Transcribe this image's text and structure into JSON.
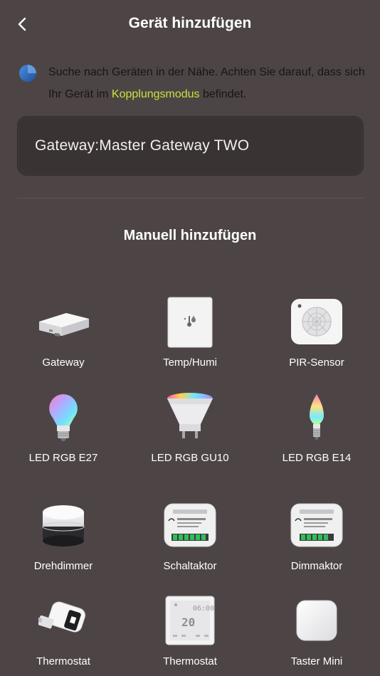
{
  "header": {
    "title": "Gerät hinzufügen"
  },
  "scan": {
    "text_before": "Suche nach Geräten in der Nähe. Achten Sie darauf, dass sich Ihr Gerät im ",
    "link": "Kopplungsmodus",
    "text_after": " befindet.",
    "link_color": "#c8e23c"
  },
  "gateway_card": {
    "label": "Gateway:Master Gateway TWO"
  },
  "manual": {
    "title": "Manuell hinzufügen"
  },
  "devices": [
    {
      "label": "Gateway",
      "icon": "gateway-hub-icon"
    },
    {
      "label": "Temp/Humi",
      "icon": "temp-humidity-sensor-icon"
    },
    {
      "label": "PIR-Sensor",
      "icon": "pir-motion-sensor-icon"
    },
    {
      "label": "LED RGB E27",
      "icon": "led-bulb-e27-icon"
    },
    {
      "label": "LED RGB GU10",
      "icon": "led-spot-gu10-icon"
    },
    {
      "label": "LED RGB E14",
      "icon": "led-candle-e14-icon"
    },
    {
      "label": "Drehdimmer",
      "icon": "rotary-dimmer-icon"
    },
    {
      "label": "Schaltaktor",
      "icon": "switch-actuator-icon"
    },
    {
      "label": "Dimmaktor",
      "icon": "dimmer-actuator-icon"
    },
    {
      "label": "Thermostat",
      "icon": "radiator-thermostat-icon"
    },
    {
      "label": "Thermostat",
      "icon": "wall-thermostat-icon"
    },
    {
      "label": "Taster Mini",
      "icon": "mini-button-icon"
    }
  ],
  "thermostat_display": {
    "time": "06:00",
    "temp": "20"
  }
}
